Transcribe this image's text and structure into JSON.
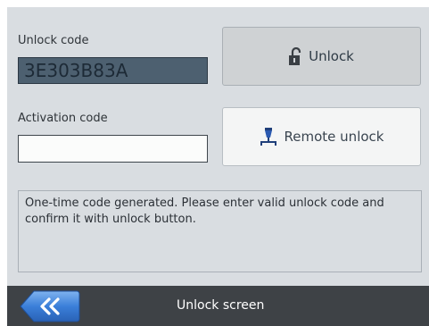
{
  "unlock_section": {
    "label": "Unlock code",
    "code_value": "3E303B83A"
  },
  "activation_section": {
    "label": "Activation code",
    "input_value": ""
  },
  "buttons": {
    "unlock_label": "Unlock",
    "unlock_icon": "lock-open-icon",
    "remote_label": "Remote unlock",
    "remote_icon": "network-icon"
  },
  "message": "One-time code generated. Please enter valid unlock code and confirm it with unlock button.",
  "footer": {
    "title": "Unlock screen",
    "back_icon": "double-chevron-left-icon"
  },
  "colors": {
    "screen_bg": "#d9dde1",
    "code_display_bg": "#4d6070",
    "footer_bg": "#3e4246",
    "accent": "#2f6fd0"
  }
}
